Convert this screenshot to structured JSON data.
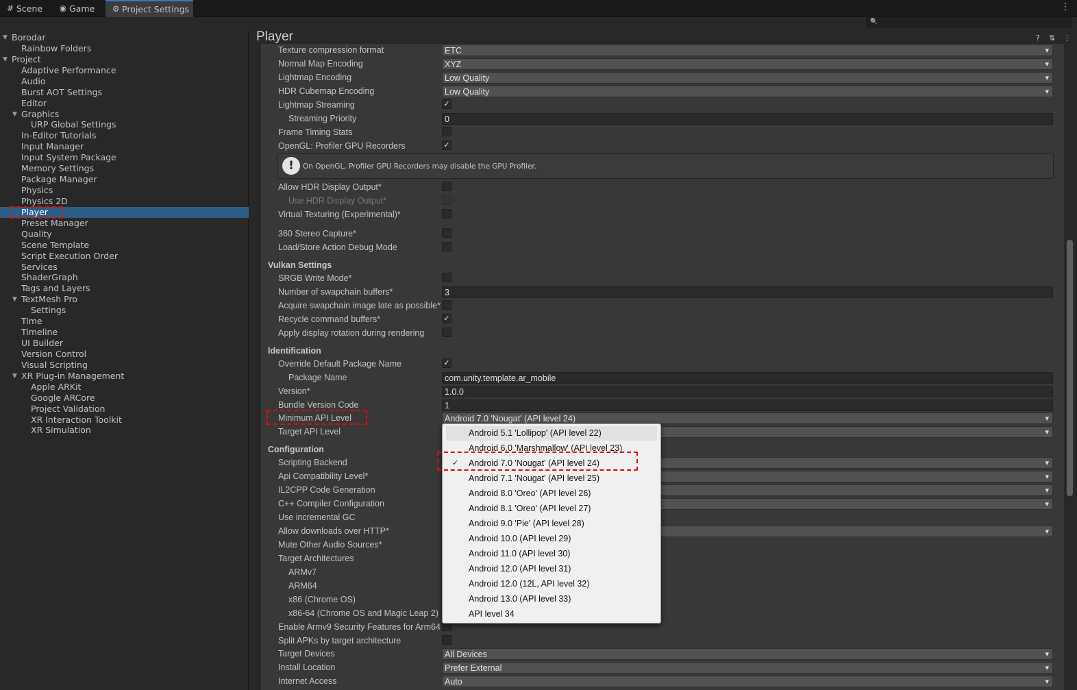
{
  "tabs": [
    {
      "icon": "scene-icon",
      "glyph": "#",
      "label": "Scene"
    },
    {
      "icon": "gamepad-icon",
      "glyph": "◉",
      "label": "Game"
    },
    {
      "icon": "gear-icon",
      "glyph": "⚙",
      "label": "Project Settings"
    }
  ],
  "window_menu_glyph": "⋮",
  "search": {
    "placeholder": "",
    "icon": "search-icon"
  },
  "tree": [
    {
      "label": "Borodar",
      "level": 0,
      "arrow": "▼"
    },
    {
      "label": "Rainbow Folders",
      "level": 1
    },
    {
      "label": "Project",
      "level": 0,
      "arrow": "▼"
    },
    {
      "label": "Adaptive Performance",
      "level": 1
    },
    {
      "label": "Audio",
      "level": 1
    },
    {
      "label": "Burst AOT Settings",
      "level": 1
    },
    {
      "label": "Editor",
      "level": 1
    },
    {
      "label": "Graphics",
      "level": 1,
      "arrow": "▼"
    },
    {
      "label": "URP Global Settings",
      "level": 2
    },
    {
      "label": "In-Editor Tutorials",
      "level": 1
    },
    {
      "label": "Input Manager",
      "level": 1
    },
    {
      "label": "Input System Package",
      "level": 1
    },
    {
      "label": "Memory Settings",
      "level": 1
    },
    {
      "label": "Package Manager",
      "level": 1
    },
    {
      "label": "Physics",
      "level": 1
    },
    {
      "label": "Physics 2D",
      "level": 1
    },
    {
      "label": "Player",
      "level": 1,
      "selected": true
    },
    {
      "label": "Preset Manager",
      "level": 1
    },
    {
      "label": "Quality",
      "level": 1
    },
    {
      "label": "Scene Template",
      "level": 1
    },
    {
      "label": "Script Execution Order",
      "level": 1
    },
    {
      "label": "Services",
      "level": 1
    },
    {
      "label": "ShaderGraph",
      "level": 1
    },
    {
      "label": "Tags and Layers",
      "level": 1
    },
    {
      "label": "TextMesh Pro",
      "level": 1,
      "arrow": "▼"
    },
    {
      "label": "Settings",
      "level": 2
    },
    {
      "label": "Time",
      "level": 1
    },
    {
      "label": "Timeline",
      "level": 1
    },
    {
      "label": "UI Builder",
      "level": 1
    },
    {
      "label": "Version Control",
      "level": 1
    },
    {
      "label": "Visual Scripting",
      "level": 1
    },
    {
      "label": "XR Plug-in Management",
      "level": 1,
      "arrow": "▼"
    },
    {
      "label": "Apple ARKit",
      "level": 2
    },
    {
      "label": "Google ARCore",
      "level": 2
    },
    {
      "label": "Project Validation",
      "level": 2
    },
    {
      "label": "XR Interaction Toolkit",
      "level": 2
    },
    {
      "label": "XR Simulation",
      "level": 2
    }
  ],
  "panel": {
    "title": "Player",
    "icons": [
      {
        "name": "help-icon",
        "glyph": "?"
      },
      {
        "name": "preset-icon",
        "glyph": "⇅"
      },
      {
        "name": "panel-menu-icon",
        "glyph": "⋮"
      }
    ]
  },
  "help_box": {
    "icon": "!",
    "text": "On OpenGL, Profiler GPU Recorders may disable the GPU Profiler."
  },
  "rows": [
    {
      "label": "Texture compression format",
      "type": "dropdown",
      "value": "ETC"
    },
    {
      "label": "Normal Map Encoding",
      "type": "dropdown",
      "value": "XYZ"
    },
    {
      "label": "Lightmap Encoding",
      "type": "dropdown",
      "value": "Low Quality"
    },
    {
      "label": "HDR Cubemap Encoding",
      "type": "dropdown",
      "value": "Low Quality"
    },
    {
      "label": "Lightmap Streaming",
      "type": "checkbox",
      "checked": true
    },
    {
      "label": "Streaming Priority",
      "type": "text",
      "value": "0",
      "indent": true
    },
    {
      "label": "Frame Timing Stats",
      "type": "checkbox",
      "checked": false
    },
    {
      "label": "OpenGL: Profiler GPU Recorders",
      "type": "checkbox",
      "checked": true
    },
    {
      "label": "Allow HDR Display Output*",
      "type": "checkbox",
      "checked": false
    },
    {
      "label": "Use HDR Display Output*",
      "type": "checkbox",
      "checked": false,
      "indent": true,
      "disabled": true
    },
    {
      "label": "Virtual Texturing (Experimental)*",
      "type": "checkbox",
      "checked": false
    },
    {
      "label": "360 Stereo Capture*",
      "type": "checkbox",
      "checked": false
    },
    {
      "label": "Load/Store Action Debug Mode",
      "type": "checkbox",
      "checked": false
    },
    {
      "label": "Vulkan Settings",
      "type": "header"
    },
    {
      "label": "SRGB Write Mode*",
      "type": "checkbox",
      "checked": false
    },
    {
      "label": "Number of swapchain buffers*",
      "type": "text",
      "value": "3"
    },
    {
      "label": "Acquire swapchain image late as possible*",
      "type": "checkbox",
      "checked": false
    },
    {
      "label": "Recycle command buffers*",
      "type": "checkbox",
      "checked": true
    },
    {
      "label": "Apply display rotation during rendering",
      "type": "checkbox",
      "checked": false
    },
    {
      "label": "Identification",
      "type": "header"
    },
    {
      "label": "Override Default Package Name",
      "type": "checkbox",
      "checked": true
    },
    {
      "label": "Package Name",
      "type": "text",
      "value": "com.unity.template.ar_mobile",
      "indent": true
    },
    {
      "label": "Version*",
      "type": "text",
      "value": "1.0.0"
    },
    {
      "label": "Bundle Version Code",
      "type": "text",
      "value": "1"
    },
    {
      "label": "Minimum API Level",
      "type": "dropdown",
      "value": "Android 7.0 'Nougat' (API level 24)"
    },
    {
      "label": "Target API Level",
      "type": "dropdown",
      "value": ""
    },
    {
      "label": "Configuration",
      "type": "header"
    },
    {
      "label": "Scripting Backend",
      "type": "dropdown",
      "value": ""
    },
    {
      "label": "Api Compatibility Level*",
      "type": "dropdown",
      "value": ""
    },
    {
      "label": "IL2CPP Code Generation",
      "type": "dropdown",
      "value": ""
    },
    {
      "label": "C++ Compiler Configuration",
      "type": "dropdown",
      "value": ""
    },
    {
      "label": "Use incremental GC",
      "type": "label"
    },
    {
      "label": "Allow downloads over HTTP*",
      "type": "dropdown",
      "value": ""
    },
    {
      "label": "Mute Other Audio Sources*",
      "type": "label"
    },
    {
      "label": "Target Architectures",
      "type": "label"
    },
    {
      "label": "ARMv7",
      "type": "label",
      "indent": true
    },
    {
      "label": "ARM64",
      "type": "label",
      "indent": true
    },
    {
      "label": "x86 (Chrome OS)",
      "type": "label",
      "indent": true
    },
    {
      "label": "x86-64 (Chrome OS and Magic Leap 2)",
      "type": "label",
      "indent": true
    },
    {
      "label": "Enable Armv9 Security Features for Arm64",
      "type": "checkbox",
      "checked": false
    },
    {
      "label": "Split APKs by target architecture",
      "type": "checkbox",
      "checked": false
    },
    {
      "label": "Target Devices",
      "type": "dropdown",
      "value": "All Devices"
    },
    {
      "label": "Install Location",
      "type": "dropdown",
      "value": "Prefer External"
    },
    {
      "label": "Internet Access",
      "type": "dropdown",
      "value": "Auto"
    }
  ],
  "popup": {
    "options": [
      {
        "label": "Android 5.1 'Lollipop' (API level 22)",
        "hover": true
      },
      {
        "label": "Android 6.0 'Marshmallow' (API level 23)"
      },
      {
        "label": "Android 7.0 'Nougat' (API level 24)",
        "selected": true
      },
      {
        "label": "Android 7.1 'Nougat' (API level 25)"
      },
      {
        "label": "Android 8.0 'Oreo' (API level 26)"
      },
      {
        "label": "Android 8.1 'Oreo' (API level 27)"
      },
      {
        "label": "Android 9.0 'Pie' (API level 28)"
      },
      {
        "label": "Android 10.0 (API level 29)"
      },
      {
        "label": "Android 11.0 (API level 30)"
      },
      {
        "label": "Android 12.0 (API level 31)"
      },
      {
        "label": "Android 12.0 (12L, API level 32)"
      },
      {
        "label": "Android 13.0 (API level 33)"
      },
      {
        "label": "API level 34"
      }
    ],
    "check_glyph": "✓"
  },
  "annotation_color": "#e10b0b"
}
